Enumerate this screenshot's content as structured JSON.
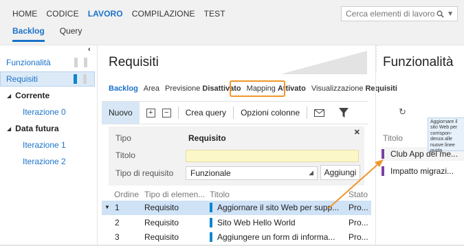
{
  "topnav": [
    "HOME",
    "CODICE",
    "LAVORO",
    "COMPILAZIONE",
    "TEST"
  ],
  "search": {
    "placeholder": "Cerca elementi di lavoro"
  },
  "subnav": [
    "Backlog",
    "Query"
  ],
  "left": {
    "items": [
      {
        "label": "Funzionalità"
      },
      {
        "label": "Requisiti"
      }
    ],
    "groups": [
      {
        "label": "Corrente",
        "children": [
          "Iterazione 0"
        ]
      },
      {
        "label": "Data futura",
        "children": [
          "Iterazione 1",
          "Iterazione 2"
        ]
      }
    ]
  },
  "center": {
    "title": "Requisiti",
    "viewbar": {
      "backlog": "Backlog",
      "area": "Area",
      "preview": "Previsione",
      "preview_state": "Disattivato",
      "mapping": "Mapping",
      "mapping_state": "Attivato",
      "view": "Visualizzazione",
      "view_value": "Requisiti"
    },
    "toolbar": {
      "new": "Nuovo",
      "create_query": "Crea query",
      "column_options": "Opzioni colonne"
    },
    "form": {
      "type_label": "Tipo",
      "type_value": "Requisito",
      "title_label": "Titolo",
      "req_type_label": "Tipo di requisito",
      "req_type_value": "Funzionale",
      "add_button": "Aggiungi"
    },
    "table": {
      "headers": [
        "Ordine",
        "Tipo di elemen...",
        "Titolo",
        "Stato"
      ],
      "rows": [
        {
          "order": "1",
          "type": "Requisito",
          "title": "Aggiornare il sito Web per supp...",
          "state": "Pro..."
        },
        {
          "order": "2",
          "type": "Requisito",
          "title": "Sito Web Hello World",
          "state": "Pro..."
        },
        {
          "order": "3",
          "type": "Requisito",
          "title": "Aggiungere un form di informa...",
          "state": "Pro..."
        }
      ]
    }
  },
  "right": {
    "title": "Funzionalità",
    "header": "Titolo",
    "tooltip": "Aggiornare il sito Web per corrispon-denza alle nuove linee guida",
    "items": [
      "Club App del me...",
      "Impatto migrazi..."
    ]
  },
  "colors": {
    "accent": "#1a72c9",
    "highlight": "#f0962a",
    "requirement_bar": "#0d86cf",
    "feature_bar": "#7b3fa3"
  }
}
